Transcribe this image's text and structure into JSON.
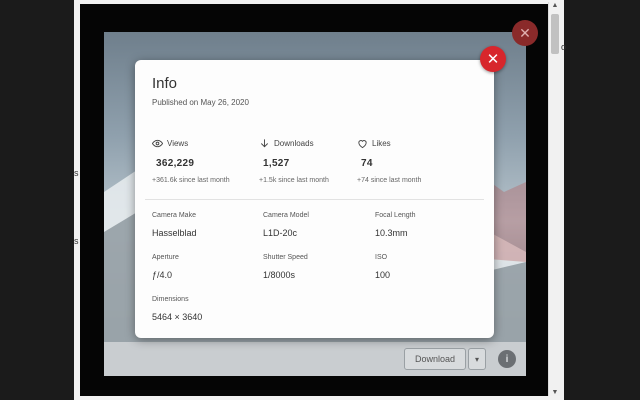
{
  "page_edge": {
    "texts": [
      "o",
      "s",
      "s"
    ]
  },
  "background_photo": {
    "download_label": "Download",
    "caret_label": "▾",
    "info_label": "i"
  },
  "background_close_label": "✕",
  "scrollbar": {
    "up": "▲",
    "down": "▼"
  },
  "modal": {
    "title": "Info",
    "published": "Published on May 26, 2020",
    "close_label": "✕",
    "stats": [
      {
        "icon": "eye-icon",
        "label": "Views",
        "value": "362,229",
        "delta": "+361.6k since last month"
      },
      {
        "icon": "download-arrow-icon",
        "label": "Downloads",
        "value": "1,527",
        "delta": "+1.5k since last month"
      },
      {
        "icon": "heart-icon",
        "label": "Likes",
        "value": "74",
        "delta": "+74 since last month"
      }
    ],
    "details": [
      {
        "label": "Camera Make",
        "value": "Hasselblad"
      },
      {
        "label": "Camera Model",
        "value": "L1D-20c"
      },
      {
        "label": "Focal Length",
        "value": "10.3mm"
      },
      {
        "label": "Aperture",
        "value": "ƒ/4.0"
      },
      {
        "label": "Shutter Speed",
        "value": "1/8000s"
      },
      {
        "label": "ISO",
        "value": "100"
      },
      {
        "label": "Dimensions",
        "value": "5464 × 3640"
      }
    ]
  },
  "colors": {
    "close_red": "#d7262c",
    "overlay": "#050505"
  }
}
